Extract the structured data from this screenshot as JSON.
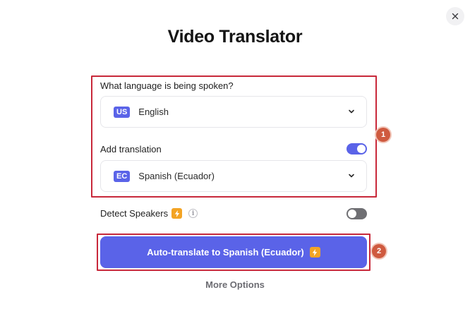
{
  "dialog": {
    "title": "Video Translator"
  },
  "spoken_language": {
    "label": "What language is being spoken?",
    "flag_code": "US",
    "selected": "English"
  },
  "translation": {
    "label": "Add translation",
    "enabled": true,
    "flag_code": "EC",
    "selected": "Spanish (Ecuador)"
  },
  "detect_speakers": {
    "label": "Detect Speakers",
    "info_symbol": "i",
    "enabled": false
  },
  "primary_action": {
    "label": "Auto-translate to Spanish (Ecuador)"
  },
  "more_options": {
    "label": "More Options"
  },
  "annotations": {
    "step_1": "1",
    "step_2": "2"
  },
  "colors": {
    "accent": "#5a63e8",
    "premium_badge": "#f3a425",
    "annotation_red": "#c8283a",
    "annotation_badge": "#cf5a3f"
  },
  "icons": {
    "close": "close-icon",
    "chevron": "chevron-down-icon",
    "premium": "lightning-bolt-icon",
    "info": "info-icon"
  }
}
